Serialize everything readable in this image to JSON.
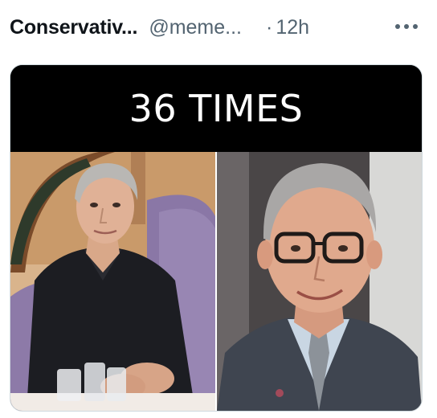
{
  "tweet": {
    "display_name": "Conservativ...",
    "handle": "@meme...",
    "separator": "·",
    "time": "12h",
    "more_icon": "more-horizontal-icon"
  },
  "media": {
    "caption": "36 TIMES",
    "left_photo": "photo-of-man-in-black-polo-shirt-seated-in-purple-booth",
    "right_photo": "photo-of-smiling-man-in-glasses-and-suit"
  },
  "colors": {
    "name_text": "#0f1419",
    "secondary_text": "#536471",
    "card_border": "#cfd9de",
    "caption_band": "#000000",
    "caption_text": "#ffffff"
  }
}
